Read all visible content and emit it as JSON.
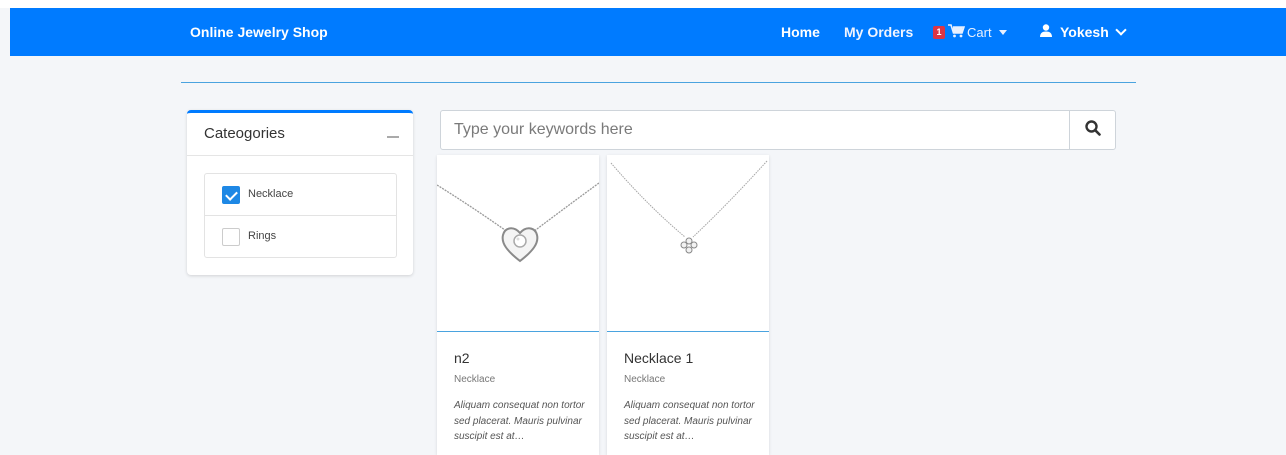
{
  "navbar": {
    "brand": "Online Jewelry Shop",
    "home": "Home",
    "orders": "My Orders",
    "cart_count": "1",
    "cart_label": "Cart",
    "user_name": "Yokesh",
    "color": "#007bff"
  },
  "categories": {
    "title": "Cateogories",
    "items": [
      {
        "label": "Necklace",
        "checked": true
      },
      {
        "label": "Rings",
        "checked": false
      }
    ]
  },
  "search": {
    "placeholder": "Type your keywords here"
  },
  "products": [
    {
      "name": "n2",
      "category": "Necklace",
      "description": "Aliquam consequat non tortor sed placerat. Mauris pulvinar suscipit est at…"
    },
    {
      "name": "Necklace 1",
      "category": "Necklace",
      "description": "Aliquam consequat non tortor sed placerat. Mauris pulvinar suscipit est at…"
    }
  ]
}
